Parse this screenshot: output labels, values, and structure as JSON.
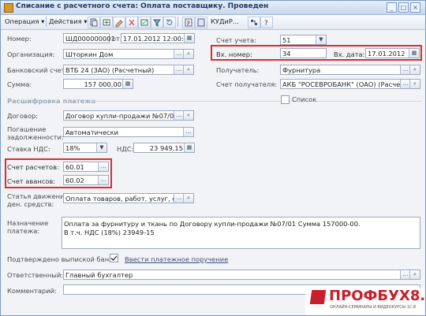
{
  "window": {
    "title": "Списание с расчетного счета: Оплата поставщику. Проведен",
    "controls": [
      "_",
      "□",
      "×"
    ]
  },
  "toolbar": {
    "operation": "Операция ▾",
    "actions": "Действия ▾",
    "kud": "КУДиР...",
    "icons": [
      "copy-icon",
      "add-icon",
      "edit-icon",
      "delete-icon",
      "mark-icon",
      "filter-icon",
      "refresh-icon",
      "accounting-icon",
      "journal-icon",
      "structure-icon"
    ]
  },
  "header": {
    "number_label": "Номер:",
    "number_value": "ШД000000001",
    "from_label": "от",
    "date_value": "17.01.2012 12:00:03",
    "org_label": "Организация:",
    "org_value": "Шторкин Дом",
    "bank_label": "Банковский счет:",
    "bank_value": "ВТБ 24 (ЗАО) (Расчетный)",
    "sum_label": "Сумма:",
    "sum_value": "157 000,00",
    "account_label": "Счет учета:",
    "account_value": "51",
    "incoming_number_label": "Вх. номер:",
    "incoming_number_value": "34",
    "incoming_date_label": "Вх. дата:",
    "incoming_date_value": "17.01.2012",
    "recipient_label": "Получатель:",
    "recipient_value": "Фурнитура",
    "recipient_account_label": "Счет получателя:",
    "recipient_account_value": "АКБ \"РОСЕВРОБАНК\" (ОАО) (Расчетны"
  },
  "decoding": {
    "section_title": "Расшифровка платежа",
    "list_label": "Список",
    "contract_label": "Договор:",
    "contract_value": "Договор купли-продажи №07/01",
    "debt_label_1": "Погашение",
    "debt_label_2": "задолженности:",
    "debt_value": "Автоматически",
    "vat_rate_label": "Ставка НДС:",
    "vat_rate_value": "18%",
    "vat_label": "НДС:",
    "vat_value": "23 949,15",
    "settlement_label": "Счет расчетов:",
    "settlement_value": "60.01",
    "advance_label": "Счет авансов:",
    "advance_value": "60.02",
    "cashflow_label_1": "Статья движения",
    "cashflow_label_2": "ден. средств:",
    "cashflow_value": "Оплата товаров, работ, услуг, сыры"
  },
  "purpose": {
    "label_1": "Назначение",
    "label_2": "платежа:",
    "line_1": "Оплата за фурнитуру и ткань по Договору купли-продажи №07/01 Сумма 157000-00.",
    "line_2": "В т.ч. НДС  (18%) 23949-15"
  },
  "footer": {
    "confirmed_label": "Подтверждено выпиской банка",
    "print_link": "Ввести платежное поручение",
    "responsible_label": "Ответственный:",
    "responsible_value": "Главный бухгалтер",
    "comment_label": "Комментарий:",
    "comment_value": ""
  },
  "watermark": {
    "main": "ПРОФБУХ8.ру",
    "sub": "ОНЛАЙН-СЕМИНАРЫ И ВИДЕОКУРСЫ 1С:8"
  },
  "colors": {
    "highlight": "#d82d33",
    "brand": "#c81f2a",
    "title_text": "#1f3b64"
  }
}
